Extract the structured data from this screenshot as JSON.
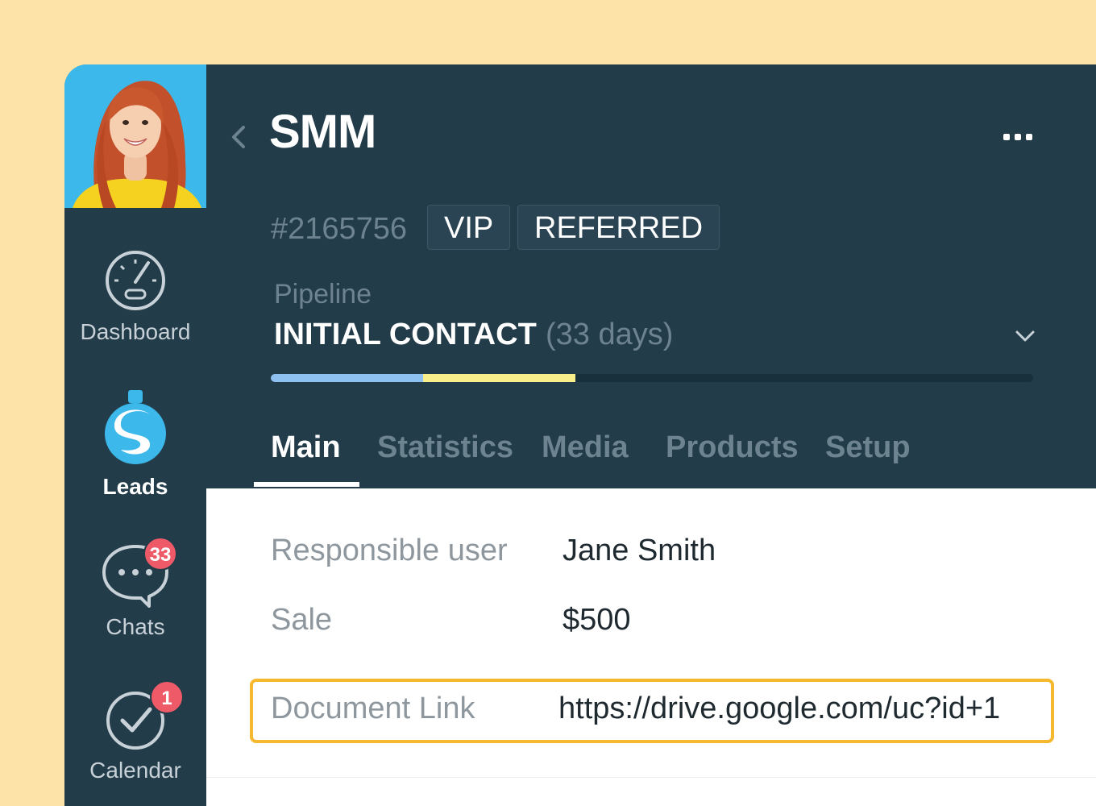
{
  "colors": {
    "page_background": "#fde3a7",
    "sidebar": "#223c4a",
    "accent_badge": "#ee5a67",
    "highlight": "#f5b82e",
    "progress_stage_1": "#8fc1f0",
    "progress_stage_2": "#f8ee8a"
  },
  "sidebar": {
    "avatar": "avatar",
    "items": [
      {
        "label": "Dashboard",
        "icon": "dashboard-gauge-icon",
        "active": false
      },
      {
        "label": "Leads",
        "icon": "leads-dollar-icon",
        "active": true
      },
      {
        "label": "Chats",
        "icon": "chat-bubble-icon",
        "active": false,
        "badge": "33"
      },
      {
        "label": "Calendar",
        "icon": "calendar-check-icon",
        "active": false,
        "badge": "1"
      }
    ]
  },
  "header": {
    "back_icon": "chevron-left-icon",
    "title": "SMM",
    "more_icon": "more-dots-icon",
    "lead_id": "#2165756",
    "tags": [
      "VIP",
      "REFERRED"
    ],
    "pipeline": {
      "label": "Pipeline",
      "stage": "INITIAL CONTACT",
      "duration": "(33 days)",
      "dropdown_icon": "chevron-down-icon",
      "progress": [
        {
          "color": "#8fc1f0",
          "fraction": 0.2
        },
        {
          "color": "#f8ee8a",
          "fraction": 0.2
        }
      ]
    },
    "tabs": [
      {
        "label": "Main",
        "active": true
      },
      {
        "label": "Statistics",
        "active": false
      },
      {
        "label": "Media",
        "active": false
      },
      {
        "label": "Products",
        "active": false
      },
      {
        "label": "Setup",
        "active": false
      }
    ]
  },
  "fields": [
    {
      "label": "Responsible user",
      "value": "Jane Smith"
    },
    {
      "label": "Sale",
      "value": "$500"
    },
    {
      "label": "Document Link",
      "value": "https://drive.google.com/uc?id+1",
      "highlighted": true
    }
  ]
}
